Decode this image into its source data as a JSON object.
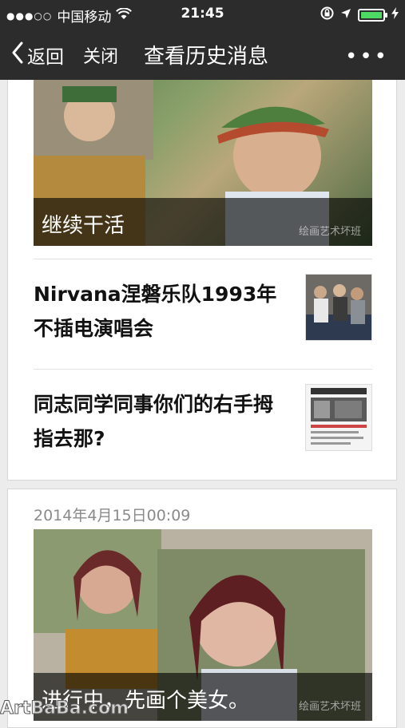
{
  "status_bar": {
    "signal": "●●●○○",
    "carrier": "中国移动",
    "time": "21:45",
    "battery_level": 1.0
  },
  "nav": {
    "back_label": "返回",
    "close_label": "关闭",
    "title": "查看历史消息",
    "more_label": "•••"
  },
  "group1": {
    "cover_caption": "继续干活",
    "cover_watermark": "绘画艺术坏班",
    "articles": [
      {
        "title": "Nirvana涅磐乐队1993年不插电演唱会"
      },
      {
        "title": "同志同学同事你们的右手拇指去那?"
      }
    ]
  },
  "group2": {
    "date": "2014年4月15日00:09",
    "cover_caption": "进行中，先画个美女。",
    "cover_watermark": "绘画艺术坏班"
  },
  "site_watermark": "ArtBaBa.com",
  "colors": {
    "bar_bg": "#2c2c2c",
    "page_bg": "#ececec",
    "battery": "#4cd964"
  }
}
